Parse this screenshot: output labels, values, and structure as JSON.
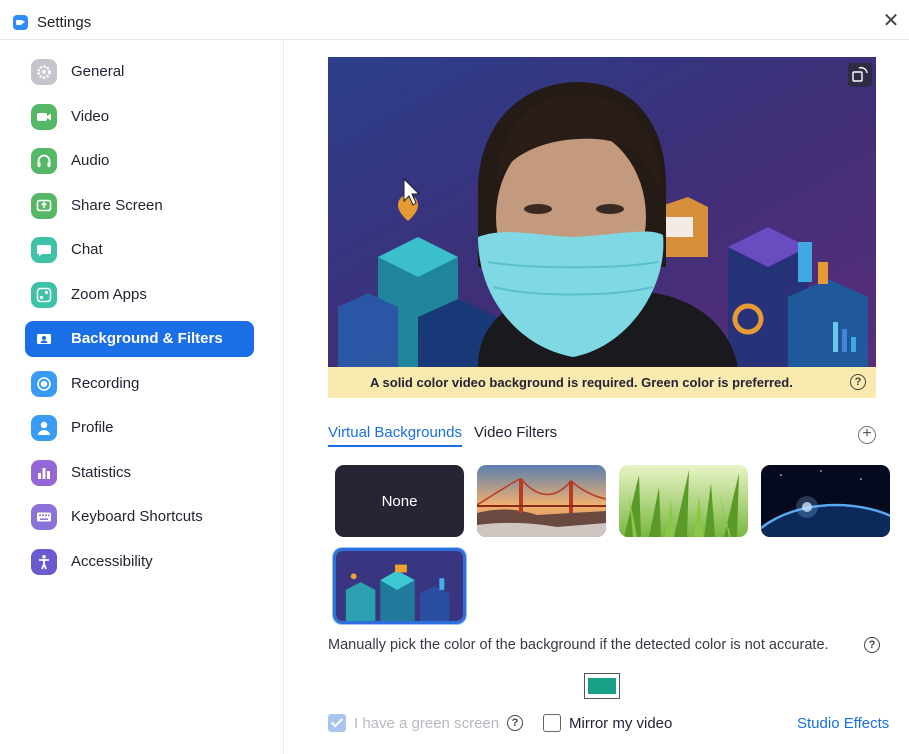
{
  "window": {
    "title": "Settings"
  },
  "sidebar": {
    "items": [
      {
        "label": "General",
        "icon": "gear-icon",
        "color": "#b9b9c2"
      },
      {
        "label": "Video",
        "icon": "video-camera-icon",
        "color": "#55b866"
      },
      {
        "label": "Audio",
        "icon": "headphones-icon",
        "color": "#55b866"
      },
      {
        "label": "Share Screen",
        "icon": "share-screen-icon",
        "color": "#55b866"
      },
      {
        "label": "Chat",
        "icon": "chat-bubble-icon",
        "color": "#3ec3a8"
      },
      {
        "label": "Zoom Apps",
        "icon": "apps-icon",
        "color": "#3ec3a8"
      },
      {
        "label": "Background & Filters",
        "icon": "portrait-icon",
        "color": "#1a6fe6",
        "active": true
      },
      {
        "label": "Recording",
        "icon": "record-icon",
        "color": "#3a9bf4"
      },
      {
        "label": "Profile",
        "icon": "person-icon",
        "color": "#3a9bf4"
      },
      {
        "label": "Statistics",
        "icon": "bar-chart-icon",
        "color": "#9466d6"
      },
      {
        "label": "Keyboard Shortcuts",
        "icon": "keyboard-icon",
        "color": "#8a72d8"
      },
      {
        "label": "Accessibility",
        "icon": "accessibility-icon",
        "color": "#6a5bd0"
      }
    ]
  },
  "preview": {
    "warning": "A solid color video background is required. Green color is preferred."
  },
  "tabs": [
    {
      "label": "Virtual Backgrounds",
      "active": true
    },
    {
      "label": "Video Filters",
      "active": false
    }
  ],
  "backgrounds": [
    {
      "name": "none",
      "label": "None"
    },
    {
      "name": "golden-gate-bridge"
    },
    {
      "name": "grass"
    },
    {
      "name": "earth-from-space"
    },
    {
      "name": "isometric-city",
      "selected": true
    }
  ],
  "manual_pick": {
    "text": "Manually pick the color of the background if the detected color is not accurate.",
    "color": "#16a086"
  },
  "options": {
    "green_screen": {
      "label": "I have a green screen",
      "checked": true,
      "disabled": true
    },
    "mirror": {
      "label": "Mirror my video",
      "checked": false
    },
    "studio_effects": "Studio Effects"
  },
  "colors": {
    "accent": "#1a6fe6",
    "warning_bg": "#fbeab0"
  }
}
